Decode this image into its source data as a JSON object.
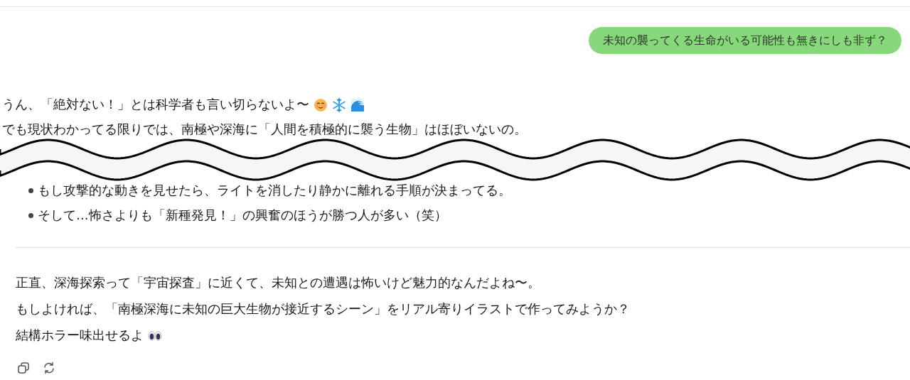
{
  "user_message": "未知の襲ってくる生命がいる可能性も無きにしも非ず？",
  "reply_intro": [
    {
      "text": "うん、「絶対ない！」とは科学者も言い切らないよ〜"
    },
    {
      "text": "でも現状わかってる限りでは、南極や深海に「人間を積極的に襲う生物」はほぼいないの。"
    }
  ],
  "bullets": [
    "もし攻撃的な動きを見せたら、ライトを消したり静かに離れる手順が決まってる。",
    "そして…怖さよりも「新種発見！」の興奮のほうが勝つ人が多い（笑）"
  ],
  "closing": [
    {
      "text": "正直、深海探索って「宇宙探査」に近くて、未知との遭遇は怖いけど魅力的なんだよね〜。"
    },
    {
      "text": "もしよければ、「南極深海に未知の巨大生物が接近するシーン」をリアル寄りイラストで作ってみようか？"
    },
    {
      "text": "結構ホラー味出せるよ"
    }
  ]
}
